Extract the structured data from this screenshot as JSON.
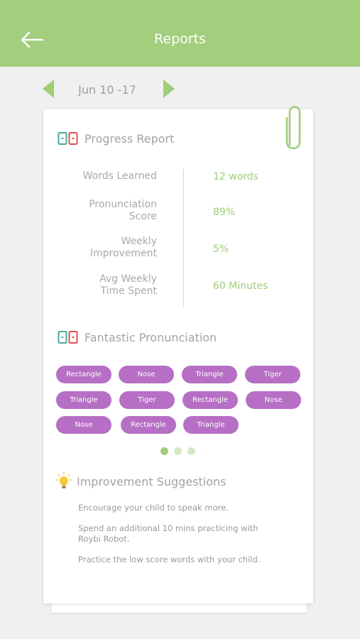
{
  "header": {
    "title": "Reports",
    "back_icon": "arrow-left-icon"
  },
  "week_nav": {
    "label": "Jun 10 -17",
    "prev_icon": "chevron-left-icon",
    "next_icon": "chevron-right-icon"
  },
  "progress": {
    "title": "Progress Report",
    "metrics": [
      {
        "label_lines": [
          "Words Learned"
        ],
        "value": "12 words"
      },
      {
        "label_lines": [
          "Pronunciation",
          "Score"
        ],
        "value": "89%"
      },
      {
        "label_lines": [
          "Weekly",
          "Improvement"
        ],
        "value": "5%"
      },
      {
        "label_lines": [
          "Avg Weekly",
          "Time Spent"
        ],
        "value": "60 Minutes"
      }
    ]
  },
  "pronunciation": {
    "title": "Fantastic Pronunciation",
    "words": [
      "Rectangle",
      "Nose",
      "Triangle",
      "Tiger",
      "Triangle",
      "Tiger",
      "Rectangle",
      "Nose",
      "Nose",
      "Rectangle",
      "Triangle"
    ],
    "pagination": {
      "count": 3,
      "active": 0
    }
  },
  "improvement": {
    "title": "Improvement Suggestions",
    "suggestions": [
      "Encourage your child to speak more.",
      "Spend an additional 10 mins practicing with Roybi Robot.",
      "Practice the low score words with your child."
    ]
  },
  "colors": {
    "brand_green": "#a2ce7d",
    "value_green": "#9fcd78",
    "chip_purple": "#b66fc4",
    "dot_light": "#d5e8c4"
  }
}
